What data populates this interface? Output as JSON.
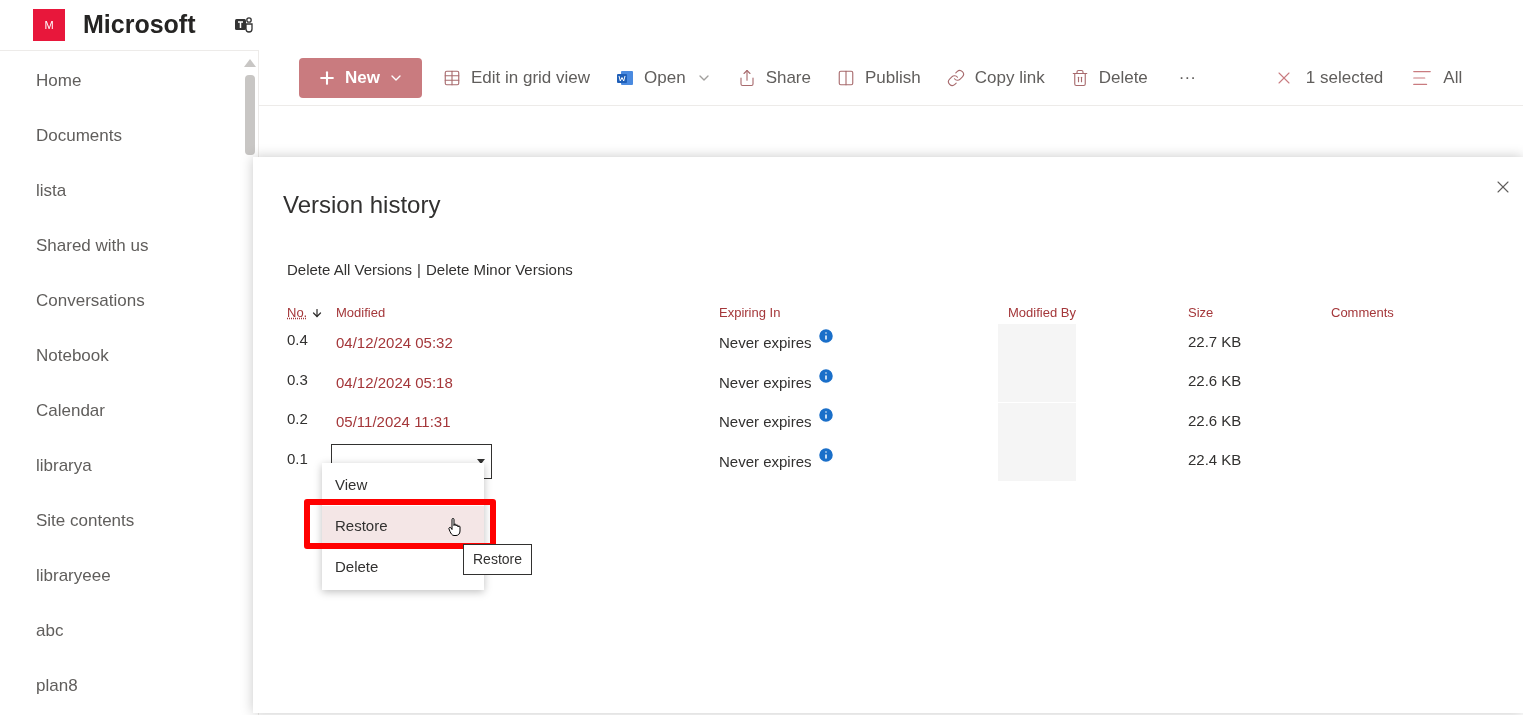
{
  "header": {
    "logo_letter": "M",
    "site_name": "Microsoft"
  },
  "sidebar": {
    "items": [
      {
        "label": "Home"
      },
      {
        "label": "Documents"
      },
      {
        "label": "lista"
      },
      {
        "label": "Shared with us"
      },
      {
        "label": "Conversations"
      },
      {
        "label": "Notebook"
      },
      {
        "label": "Calendar"
      },
      {
        "label": "librarya"
      },
      {
        "label": "Site contents"
      },
      {
        "label": "libraryeee"
      },
      {
        "label": "abc"
      },
      {
        "label": "plan8"
      }
    ]
  },
  "toolbar": {
    "items": [
      {
        "kind": "new",
        "label": "New"
      },
      {
        "kind": "grid",
        "label": "Edit in grid view"
      },
      {
        "kind": "open",
        "label": "Open"
      },
      {
        "kind": "share",
        "label": "Share"
      },
      {
        "kind": "publish",
        "label": "Publish"
      },
      {
        "kind": "link",
        "label": "Copy link"
      },
      {
        "kind": "delete",
        "label": "Delete"
      },
      {
        "kind": "more",
        "label": "···"
      }
    ],
    "selection": "1 selected",
    "view": "All"
  },
  "dialog": {
    "title": "Version history",
    "actions": [
      "Delete All Versions",
      "Delete Minor Versions"
    ],
    "separator": "|",
    "columns": [
      "No.",
      "Modified",
      "Expiring In",
      "Modified By",
      "Size",
      "Comments"
    ],
    "rows": [
      {
        "no": "0.4",
        "modified": "04/12/2024 05:32",
        "expiring": "Never expires",
        "size": "22.7 KB",
        "menu_open": false
      },
      {
        "no": "0.3",
        "modified": "04/12/2024 05:18",
        "expiring": "Never expires",
        "size": "22.6 KB",
        "menu_open": false
      },
      {
        "no": "0.2",
        "modified": "05/11/2024 11:31",
        "expiring": "Never expires",
        "size": "22.6 KB",
        "menu_open": false
      },
      {
        "no": "0.1",
        "expiring": "Never expires",
        "size": "22.4 KB",
        "menu_open": true
      }
    ],
    "menu": {
      "items": [
        {
          "label": "View",
          "selected": false
        },
        {
          "label": "Restore",
          "selected": true
        },
        {
          "label": "Delete",
          "selected": false
        }
      ]
    },
    "tooltip": "Restore"
  }
}
